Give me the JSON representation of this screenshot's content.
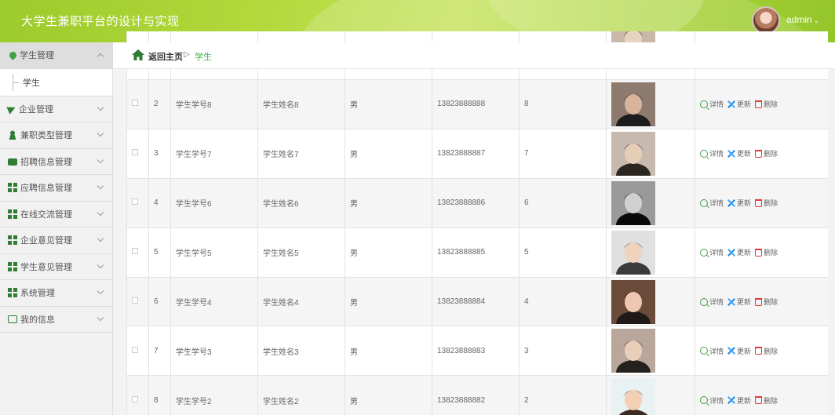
{
  "header": {
    "title": "大学生兼职平台的设计与实现",
    "user": "admin"
  },
  "breadcrumb": {
    "home": "返回主页",
    "separator": "▷",
    "current": "学生"
  },
  "sidebar": {
    "items": [
      {
        "label": "学生管理",
        "icon": "location-pin-icon",
        "active": true,
        "sub": [
          "学生"
        ]
      },
      {
        "label": "企业管理",
        "icon": "paper-plane-icon"
      },
      {
        "label": "兼职类型管理",
        "icon": "user-icon"
      },
      {
        "label": "招聘信息管理",
        "icon": "briefcase-icon"
      },
      {
        "label": "应聘信息管理",
        "icon": "grid-icon"
      },
      {
        "label": "在线交流管理",
        "icon": "grid-icon"
      },
      {
        "label": "企业意见管理",
        "icon": "grid-icon"
      },
      {
        "label": "学生意见管理",
        "icon": "grid-icon"
      },
      {
        "label": "系统管理",
        "icon": "grid-icon"
      },
      {
        "label": "我的信息",
        "icon": "id-card-icon"
      }
    ]
  },
  "actions": {
    "detail": "详情",
    "update": "更新",
    "delete": "删除"
  },
  "rows": [
    {
      "index": "",
      "student_no": "",
      "name": "",
      "gender": "",
      "phone": "",
      "extra": ""
    },
    {
      "index": "2",
      "student_no": "学生学号8",
      "name": "学生姓名8",
      "gender": "男",
      "phone": "13823888888",
      "extra": "8"
    },
    {
      "index": "3",
      "student_no": "学生学号7",
      "name": "学生姓名7",
      "gender": "男",
      "phone": "13823888887",
      "extra": "7"
    },
    {
      "index": "4",
      "student_no": "学生学号6",
      "name": "学生姓名6",
      "gender": "男",
      "phone": "13823888886",
      "extra": "6"
    },
    {
      "index": "5",
      "student_no": "学生学号5",
      "name": "学生姓名5",
      "gender": "男",
      "phone": "13823888885",
      "extra": "5"
    },
    {
      "index": "6",
      "student_no": "学生学号4",
      "name": "学生姓名4",
      "gender": "男",
      "phone": "13823888884",
      "extra": "4"
    },
    {
      "index": "7",
      "student_no": "学生学号3",
      "name": "学生姓名3",
      "gender": "男",
      "phone": "13823888883",
      "extra": "3"
    },
    {
      "index": "8",
      "student_no": "学生学号2",
      "name": "学生姓名2",
      "gender": "男",
      "phone": "13823888882",
      "extra": "2"
    }
  ],
  "colors": {
    "accent": "#4caf50",
    "header_green": "#a9d33a"
  }
}
